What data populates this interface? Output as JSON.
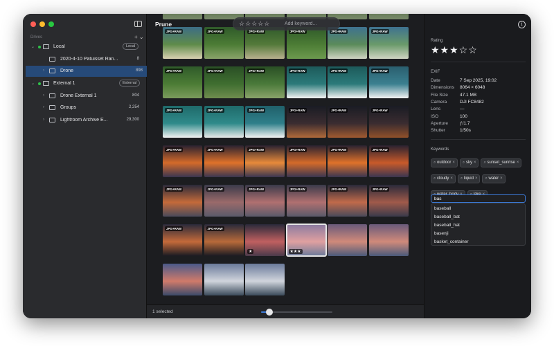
{
  "app": {
    "title": "Prune"
  },
  "sidebar": {
    "section_label": "Drives",
    "add_icon": "+ ⌄",
    "items": [
      {
        "name": "drive-local",
        "label": "Local",
        "tag": "Local",
        "type": "drive"
      },
      {
        "name": "folder-patuisset",
        "label": "2020-4-10 Patuisset Ran...",
        "count": "8",
        "type": "folder"
      },
      {
        "name": "folder-drone",
        "label": "Drone",
        "count": "898",
        "type": "folder",
        "selected": true
      },
      {
        "name": "drive-external-1",
        "label": "External 1",
        "tag": "External",
        "type": "drive"
      },
      {
        "name": "folder-drone-external",
        "label": "Drone External 1",
        "count": "804",
        "type": "folder"
      },
      {
        "name": "folder-groups",
        "label": "Groups",
        "count": "2,254",
        "type": "folder"
      },
      {
        "name": "folder-lightroom",
        "label": "Lightroom Archive E...",
        "count": "29,300",
        "type": "folder"
      }
    ]
  },
  "toolbar": {
    "rating_stars": "☆☆☆☆☆",
    "keyword_placeholder": "Add keyword..."
  },
  "grid": {
    "badge": "JPG+RAW",
    "columns": 6,
    "thumbs": [
      {
        "palette": [
          "#2b3a2a",
          "#4f6a44",
          "#7a8a6a"
        ]
      },
      {
        "palette": [
          "#2b3a2a",
          "#4f6a44",
          "#7a8a6a"
        ]
      },
      {
        "palette": [
          "#2b3a2a",
          "#4f6a44",
          "#7a8a6a"
        ]
      },
      {
        "palette": [
          "#2b3a2a",
          "#4f6a44",
          "#7a8a6a"
        ]
      },
      {
        "palette": [
          "#2b3a2a",
          "#4f6a44",
          "#7a8a6a"
        ]
      },
      {
        "palette": [
          "#2b3a2a",
          "#4f6a44",
          "#7a8a6a"
        ]
      },
      {
        "badge": true,
        "palette": [
          "#3c6d86",
          "#5f8b4a",
          "#d8d0b0"
        ]
      },
      {
        "badge": true,
        "palette": [
          "#2f5a2a",
          "#4c7c35",
          "#8aa36a"
        ]
      },
      {
        "badge": true,
        "palette": [
          "#2f5a2a",
          "#547a3a",
          "#b7b08e"
        ]
      },
      {
        "badge": true,
        "palette": [
          "#2f5a2a",
          "#4c7c35",
          "#6c9a4e"
        ]
      },
      {
        "badge": true,
        "palette": [
          "#3e7290",
          "#5b8b5a",
          "#cfd4c2"
        ]
      },
      {
        "badge": true,
        "palette": [
          "#3e7290",
          "#6a9a6a",
          "#cfd4c2"
        ]
      },
      {
        "badge": true,
        "palette": [
          "#2f5a2a",
          "#4c7c35",
          "#7b9b5c"
        ]
      },
      {
        "badge": true,
        "palette": [
          "#2a4f25",
          "#3f6e30",
          "#6f8d4e"
        ]
      },
      {
        "badge": true,
        "palette": [
          "#2a4f25",
          "#4a7a3a",
          "#8aa36a"
        ]
      },
      {
        "badge": true,
        "palette": [
          "#1d5a5a",
          "#2b7a7a",
          "#f2f2f2"
        ]
      },
      {
        "badge": true,
        "palette": [
          "#1d5a5a",
          "#2b7a7a",
          "#f2f2f2"
        ]
      },
      {
        "badge": true,
        "palette": [
          "#2a5e6e",
          "#3b8090",
          "#f2f2f2"
        ]
      },
      {
        "badge": true,
        "palette": [
          "#1f6a6a",
          "#2f8a8a",
          "#f2f2f2"
        ]
      },
      {
        "badge": true,
        "palette": [
          "#1f6a6a",
          "#2f8a8a",
          "#e8e8e8"
        ]
      },
      {
        "badge": true,
        "palette": [
          "#20606a",
          "#2f7f8a",
          "#f2f2f2"
        ]
      },
      {
        "badge": true,
        "palette": [
          "#1a1c24",
          "#3a2c30",
          "#b06a3a"
        ]
      },
      {
        "badge": true,
        "palette": [
          "#1a1c24",
          "#3a2c30",
          "#a05a30"
        ]
      },
      {
        "badge": true,
        "palette": [
          "#1a1c24",
          "#3a2c30",
          "#90502a"
        ]
      },
      {
        "badge": true,
        "palette": [
          "#2a2230",
          "#d46a2a",
          "#3a3550"
        ]
      },
      {
        "badge": true,
        "palette": [
          "#2a2230",
          "#e0722a",
          "#3a3550"
        ]
      },
      {
        "badge": true,
        "palette": [
          "#2a2230",
          "#e88a3a",
          "#3a3550"
        ]
      },
      {
        "badge": true,
        "palette": [
          "#2a2230",
          "#d46a2a",
          "#3a3550"
        ]
      },
      {
        "badge": true,
        "palette": [
          "#2a2230",
          "#e0722a",
          "#3a3550"
        ]
      },
      {
        "badge": true,
        "palette": [
          "#2a2230",
          "#c85a2a",
          "#3a3550"
        ]
      },
      {
        "badge": true,
        "palette": [
          "#2a2a3a",
          "#c46a3a",
          "#4a4a5a"
        ]
      },
      {
        "badge": true,
        "palette": [
          "#3a3a4a",
          "#9a6a6a",
          "#5a5a6a"
        ]
      },
      {
        "badge": true,
        "palette": [
          "#3a3a4a",
          "#b07070",
          "#5a5a6a"
        ]
      },
      {
        "badge": true,
        "palette": [
          "#3a3a4a",
          "#b07070",
          "#5a5a6a"
        ]
      },
      {
        "badge": true,
        "palette": [
          "#2a2a3a",
          "#c06a4a",
          "#4a4a5a"
        ]
      },
      {
        "badge": true,
        "palette": [
          "#2a2a3a",
          "#a05a4a",
          "#3a3a4a"
        ]
      },
      {
        "badge": true,
        "palette": [
          "#2a2a3a",
          "#c46a3a",
          "#1a1a22"
        ]
      },
      {
        "badge": true,
        "palette": [
          "#2a2a3a",
          "#b86a3a",
          "#1a1a22"
        ]
      },
      {
        "rating": "★",
        "palette": [
          "#2a2a3a",
          "#c06060",
          "#4a3a4a"
        ]
      },
      {
        "rating": "★★★",
        "selected": true,
        "palette": [
          "#8a7aa0",
          "#e0a0a0",
          "#6a7a9a"
        ]
      },
      {
        "palette": [
          "#6a5a7a",
          "#d08a7a",
          "#4a5a7a"
        ]
      },
      {
        "palette": [
          "#6a5a7a",
          "#d08a7a",
          "#4a5a7a"
        ]
      },
      {
        "palette": [
          "#4a5a8a",
          "#d07a6a",
          "#3a4a6a"
        ]
      },
      {
        "palette": [
          "#6a7a9a",
          "#d0d4dc",
          "#3a4a5a"
        ]
      },
      {
        "palette": [
          "#6a7a9a",
          "#d0d4dc",
          "#3a4a5a"
        ]
      }
    ]
  },
  "bottom_bar": {
    "selected_text": "1 selected",
    "zoom": 0.12
  },
  "inspector": {
    "rating_label": "Rating",
    "rating_value": 3,
    "rating_max": 5,
    "rating_stars": "★★★☆☆",
    "exif_label": "EXIF",
    "exif": [
      {
        "key": "Date",
        "value": "7 Sep 2025, 19:02"
      },
      {
        "key": "Dimensions",
        "value": "8064 × 6048"
      },
      {
        "key": "File Size",
        "value": "47.1 MB"
      },
      {
        "key": "Camera",
        "value": "DJI FC8482"
      },
      {
        "key": "Lens",
        "value": "—"
      },
      {
        "key": "ISO",
        "value": "100"
      },
      {
        "key": "Aperture",
        "value": "ƒ/1.7"
      },
      {
        "key": "Shutter",
        "value": "1/50s"
      }
    ],
    "keywords_label": "Keywords",
    "keywords": [
      "outdoor",
      "sky",
      "sunset_sunrise",
      "cloudy",
      "liquid",
      "water",
      "water_body",
      "lake"
    ],
    "keyword_input_value": "bas",
    "suggestions": [
      "baseball",
      "baseball_bat",
      "baseball_hat",
      "basenji",
      "basket_container"
    ]
  }
}
